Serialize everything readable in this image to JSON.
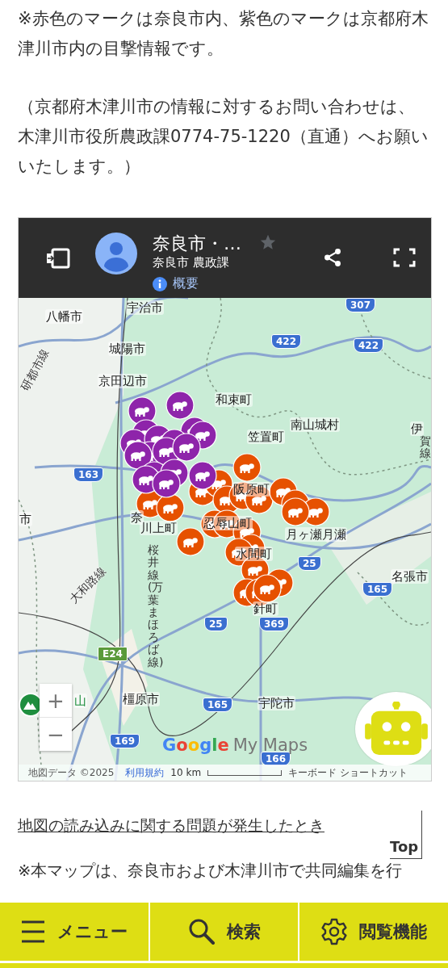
{
  "notes": [
    "※赤色のマークは奈良市内、紫色のマークは京都府木津川市内の目撃情報です。",
    "（京都府木津川市の情報に対するお問い合わせは、木津川市役所農政課0774-75-1220（直通）へお願いいたします。）"
  ],
  "map": {
    "header": {
      "title": "奈良市・…",
      "subtitle": "奈良市 農政課",
      "about": "概要"
    },
    "places": [
      "宇治市",
      "八幡市",
      "城陽市",
      "京田辺市",
      "和束町",
      "南山城村",
      "笠置町",
      "伊",
      "阪原町",
      "奈",
      "川上町",
      "忍辱山町",
      "月ヶ瀬月瀬",
      "水間町",
      "名張市",
      "針町",
      "橿原市",
      "宇陀市",
      "市",
      "山"
    ],
    "rail_lines": [
      "研都市線",
      "大和路線",
      "桜井線(万葉まほろば線)",
      "賀線"
    ],
    "route_numbers": [
      "307",
      "422",
      "422",
      "163",
      "25",
      "165",
      "25",
      "369",
      "E24",
      "165",
      "169",
      "166"
    ],
    "zoom_in": "+",
    "zoom_out": "−",
    "logo": {
      "brand": "Google",
      "product": "My Maps"
    },
    "attribution": {
      "map_data": "地図データ ©2025",
      "terms": "利用規約",
      "scale": "10 km",
      "shortcuts": "キーボード ショートカット"
    }
  },
  "load_problem_link": "地図の読み込みに関する問題が発生したとき",
  "footnote": "※本マップは、奈良市および木津川市で共同編集を行",
  "top_button": "Top",
  "nav": [
    {
      "kind": "menu",
      "label": "メニュー"
    },
    {
      "kind": "search",
      "label": "検索"
    },
    {
      "kind": "settings",
      "label": "閲覧機能"
    }
  ]
}
